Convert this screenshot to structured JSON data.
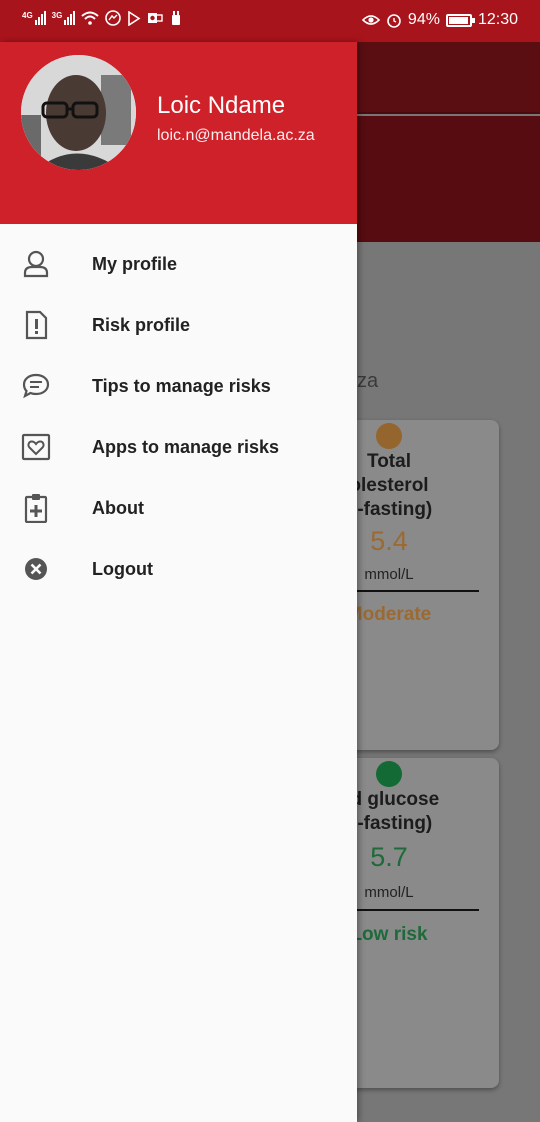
{
  "status_bar": {
    "network_left": "4G",
    "network_right": "3G",
    "battery_percent_label": "94%",
    "battery_level": 0.94,
    "time": "12:30"
  },
  "background_app": {
    "email_fragment": "za",
    "cards": [
      {
        "title_lines": [
          "Total",
          "olesterol",
          "n-fasting)"
        ],
        "value": "5.4",
        "unit": "mmol/L",
        "risk": "Moderate",
        "color": "#9a6a32",
        "dot_color": "#94652c"
      },
      {
        "title_lines": [
          "od glucose",
          "n-fasting)"
        ],
        "value": "5.7",
        "unit": "mmol/L",
        "risk": "Low risk",
        "color": "#1e6a3a",
        "dot_color": "#136a35"
      }
    ]
  },
  "drawer": {
    "user": {
      "name": "Loic Ndame",
      "email": "loic.n@mandela.ac.za"
    },
    "menu": [
      {
        "label": "My profile",
        "icon": "person-icon"
      },
      {
        "label": "Risk profile",
        "icon": "document-alert-icon"
      },
      {
        "label": "Tips to manage risks",
        "icon": "chat-bubble-icon"
      },
      {
        "label": "Apps to manage risks",
        "icon": "heart-box-icon"
      },
      {
        "label": "About",
        "icon": "clipboard-plus-icon"
      },
      {
        "label": "Logout",
        "icon": "close-circle-icon"
      }
    ]
  },
  "colors": {
    "status_bar": "#a8141b",
    "drawer_header": "#cf2129",
    "icon_gray": "#555555"
  }
}
